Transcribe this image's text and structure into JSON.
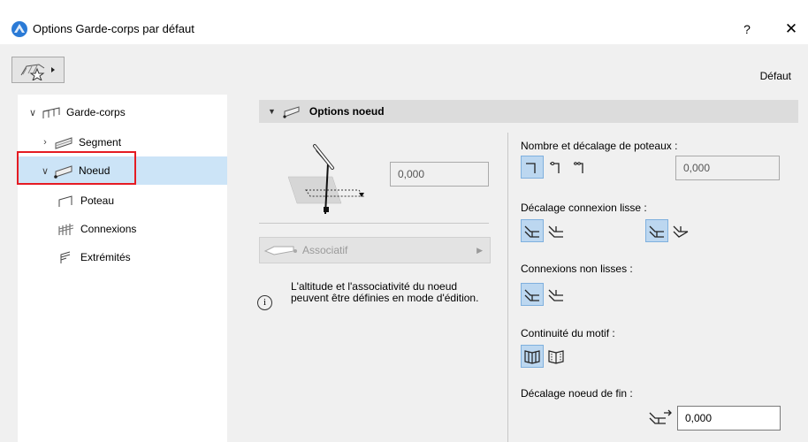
{
  "window": {
    "title": "Options Garde-corps par défaut",
    "help_label": "?",
    "close_label": "✕"
  },
  "toolbar": {
    "default_label": "Défaut"
  },
  "tree": {
    "items": [
      {
        "label": "Garde-corps"
      },
      {
        "label": "Segment"
      },
      {
        "label": "Noeud"
      },
      {
        "label": "Poteau"
      },
      {
        "label": "Connexions"
      },
      {
        "label": "Extrémités"
      }
    ]
  },
  "panel": {
    "section_title": "Options noeud",
    "elevation_value": "0,000",
    "associative_label": "Associatif",
    "info_text": "L'altitude et l'associativité du noeud peuvent être définies en mode d'édition.",
    "post_count_label": "Nombre et décalage de poteaux :",
    "post_offset_value": "0,000",
    "smooth_offset_label": "Décalage connexion lisse :",
    "non_smooth_label": "Connexions non lisses :",
    "pattern_label": "Continuité du motif :",
    "end_offset_label": "Décalage noeud de fin :",
    "end_offset_value": "0,000"
  },
  "colors": {
    "selection": "#cce4f7",
    "highlight_border": "#e51c23",
    "selected_button": "#bcd7f0"
  }
}
